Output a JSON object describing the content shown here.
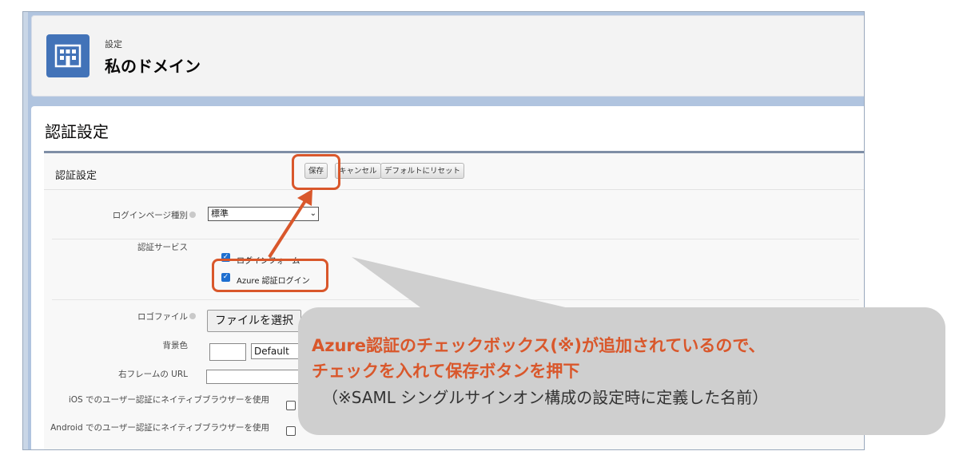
{
  "header": {
    "breadcrumb": "設定",
    "title": "私のドメイン",
    "icon": "building-icon"
  },
  "section": {
    "title": "認証設定"
  },
  "block": {
    "title": "認証設定",
    "buttons": {
      "save": "保存",
      "cancel": "キャンセル",
      "reset": "デフォルトにリセット"
    }
  },
  "form": {
    "login_page_type": {
      "label": "ログインページ種別",
      "value": "標準"
    },
    "auth_service": {
      "label": "認証サービス",
      "options": [
        {
          "label": "ログインフォーム",
          "checked": true
        },
        {
          "label": "Azure 認証ログイン",
          "checked": true
        }
      ]
    },
    "logo_file": {
      "label": "ロゴファイル",
      "button": "ファイルを選択"
    },
    "background_color": {
      "label": "背景色",
      "value": "Default"
    },
    "right_frame_url": {
      "label": "右フレームの URL",
      "value": ""
    },
    "ios_native_browser": {
      "label": "iOS でのユーザー認証にネイティブブラウザーを使用",
      "checked": false
    },
    "android_native_browser": {
      "label": "Android でのユーザー認証にネイティブブラウザーを使用",
      "checked": false
    }
  },
  "annotation": {
    "line1": "Azure認証のチェックボックス(※)が追加されているので、",
    "line2": "チェックを入れて保存ボタンを押下",
    "line3": "（※SAML シングルサインオン構成の設定時に定義した名前）",
    "accent_color": "#d9572b",
    "bubble_color": "#cfcfcf"
  }
}
